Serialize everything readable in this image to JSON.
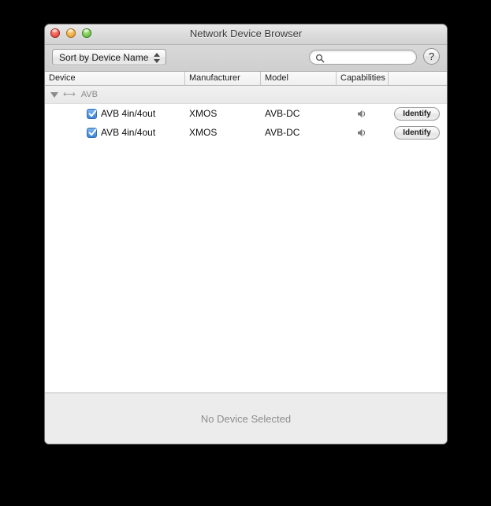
{
  "window": {
    "title": "Network Device Browser",
    "traffic_lights": [
      {
        "name": "close",
        "color": "#e24b3f"
      },
      {
        "name": "minimize",
        "color": "#e9a43a"
      },
      {
        "name": "maximize",
        "color": "#66bb45"
      }
    ]
  },
  "toolbar": {
    "sort_popup_value": "Sort by Device Name",
    "sort_popup_icon": "stepper-updown-icon",
    "search": {
      "value": "",
      "placeholder": "",
      "icon": "search-icon"
    },
    "help_button_label": "?",
    "help_button_icon": "question-mark-icon"
  },
  "table": {
    "columns": [
      {
        "key": "device",
        "label": "Device"
      },
      {
        "key": "manufacturer",
        "label": "Manufacturer"
      },
      {
        "key": "model",
        "label": "Model"
      },
      {
        "key": "capabilities",
        "label": "Capabilities"
      },
      {
        "key": "action",
        "label": ""
      }
    ],
    "group": {
      "label": "AVB",
      "expanded": true,
      "disclosure_icon": "triangle-down-icon",
      "network_icon": "left-right-arrow-icon"
    },
    "rows": [
      {
        "checked": true,
        "device": "AVB 4in/4out",
        "manufacturer": "XMOS",
        "model": "AVB-DC",
        "capability_icon": "speaker-icon",
        "action_label": "Identify"
      },
      {
        "checked": true,
        "device": "AVB 4in/4out",
        "manufacturer": "XMOS",
        "model": "AVB-DC",
        "capability_icon": "speaker-icon",
        "action_label": "Identify"
      }
    ]
  },
  "footer": {
    "status_text": "No Device Selected"
  },
  "colors": {
    "checkbox_accent": "#3d86d8",
    "group_text": "#8a8a8a",
    "footer_text": "#8d8d8d",
    "window_bg": "#ffffff",
    "desktop_bg": "#000000"
  }
}
